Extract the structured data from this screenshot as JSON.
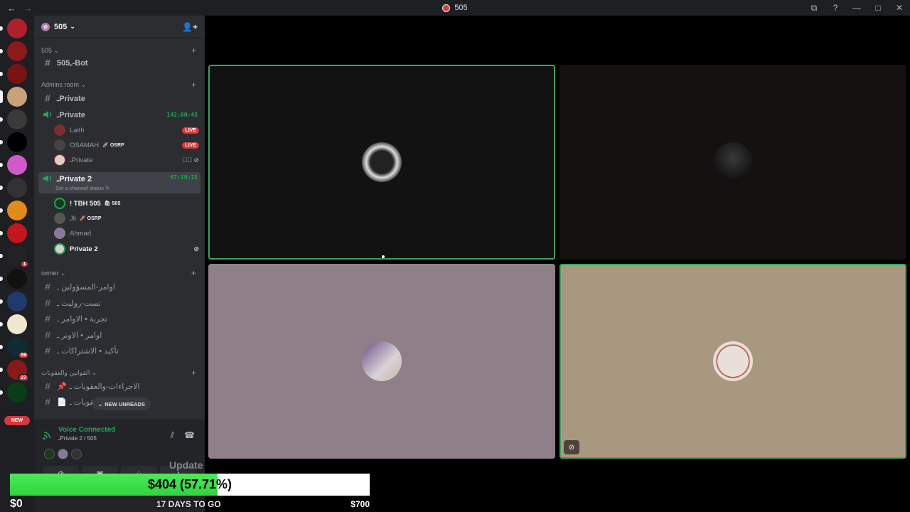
{
  "titlebar": {
    "back": "←",
    "forward": "→",
    "title": "505",
    "icons": [
      "⧉",
      "?",
      "—",
      "□",
      "✕"
    ]
  },
  "rail": {
    "servers": [
      {
        "color": "#b0202a"
      },
      {
        "color": "#8b1a1a"
      },
      {
        "color": "#7a1414"
      },
      {
        "color": "#c9a27a"
      },
      {
        "color": "#3a3a3a"
      },
      {
        "color": "#000000"
      },
      {
        "color": "#d05ac8"
      },
      {
        "color": "#333333"
      },
      {
        "color": "#e08b1c"
      },
      {
        "color": "#c4161c"
      },
      {
        "color": "#222222",
        "badge": "1"
      },
      {
        "color": "#111111"
      },
      {
        "color": "#1e3a6e"
      },
      {
        "color": "#f1e6cf"
      },
      {
        "color": "#0f2b33",
        "badge": "59"
      },
      {
        "color": "#8a1a1a",
        "badge": "27"
      },
      {
        "color": "#0b3d16"
      }
    ],
    "new_label": "NEW"
  },
  "guild": {
    "name": "505",
    "caret": "⌄",
    "invite_icon": "👤+"
  },
  "categories": {
    "c505": "505",
    "admins": "Admins room",
    "owner": "owner",
    "rules": "القوانين والعقوبات"
  },
  "channels": {
    "bot": "ـ505-Bot",
    "private_text": "ـPrivate",
    "private_voice": "ـPrivate",
    "private_voice_timer": "142:00:43",
    "private2": "ـPrivate 2",
    "private2_timer": "67:19:15",
    "private2_status": "Set a channel status ✎",
    "owner1": "اوامر-المسؤولين ـ",
    "owner2": "تست-روليت ـ",
    "owner3": "تجربة • الاوامر ـ",
    "owner4": "اوامر • الاونر ـ",
    "owner5": "تأكيد • الاشتراكات ـ",
    "rules1": "الاجراءات-والعقوبات ـ",
    "rules2": "العقوبات ـ"
  },
  "users": {
    "laith": "Laith",
    "osamah": "OSAMAH",
    "osamah_tag": "🚀 OSRP",
    "private_bot": "ـPrivate",
    "tbh": "! TBH 505",
    "tbh_tag": "🛍 505",
    "jli": "Jli",
    "jli_tag": "🚀 OSRP",
    "ahmad": "Ahmad.",
    "private2_bot": "Private 2",
    "live": "LIVE"
  },
  "new_unreads": "NEW UNREADS",
  "voice": {
    "connected": "Voice Connected",
    "location": "ـPrivate 2 / 505"
  },
  "goal": {
    "amount": "$404 (57.71%)",
    "progress": 0.5771,
    "min": "$0",
    "days": "17 DAYS TO GO",
    "max": "$700",
    "update": "Update"
  },
  "colors": {
    "speaking": "#3ba55d",
    "live": "#da373c",
    "goal_fill": "#2fd43f"
  }
}
